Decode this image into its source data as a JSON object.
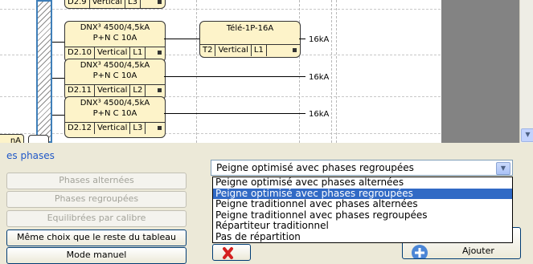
{
  "schematic": {
    "top_partial": {
      "ref": "D2.9",
      "orientation": "Vertical",
      "phase": "L3"
    },
    "partial_left_label": "nA",
    "breakers": [
      {
        "model": "DNX³ 4500/4,5kA",
        "poles": "P+N C 10A",
        "ref": "D2.10",
        "orientation": "Vertical",
        "phase": "L1",
        "rating": "16kA"
      },
      {
        "model": "DNX³ 4500/4,5kA",
        "poles": "P+N C 10A",
        "ref": "D2.11",
        "orientation": "Vertical",
        "phase": "L2",
        "rating": "16kA"
      },
      {
        "model": "DNX³ 4500/4,5kA",
        "poles": "P+N C 10A",
        "ref": "D2.12",
        "orientation": "Vertical",
        "phase": "L3",
        "rating": "16kA"
      }
    ],
    "remote": {
      "name": "Télé-1P-16A",
      "ref": "T2",
      "orientation": "Vertical",
      "phase": "L1"
    }
  },
  "phases": {
    "title": "es phases",
    "buttons": [
      {
        "label": "Phases alternées",
        "enabled": false
      },
      {
        "label": "Phases regroupées",
        "enabled": false
      },
      {
        "label": "Equilibrées par calibre",
        "enabled": false
      },
      {
        "label": "Même choix que le reste du tableau",
        "enabled": true
      },
      {
        "label": "Mode manuel",
        "enabled": true
      }
    ]
  },
  "select": {
    "value": "Peigne optimisé avec phases regroupées",
    "options": [
      "Peigne optimisé avec phases alternées",
      "Peigne optimisé avec phases regroupées",
      "Peigne traditionnel avec phases alternées",
      "Peigne traditionnel avec phases regroupées",
      "Répartiteur traditionnel",
      "Pas de répartition"
    ],
    "highlighted_index": 1
  },
  "add_button": {
    "label": "Ajouter"
  },
  "colors": {
    "accent": "#316ac5",
    "breaker_fill": "#fdf3c9",
    "title": "#2058c8"
  }
}
